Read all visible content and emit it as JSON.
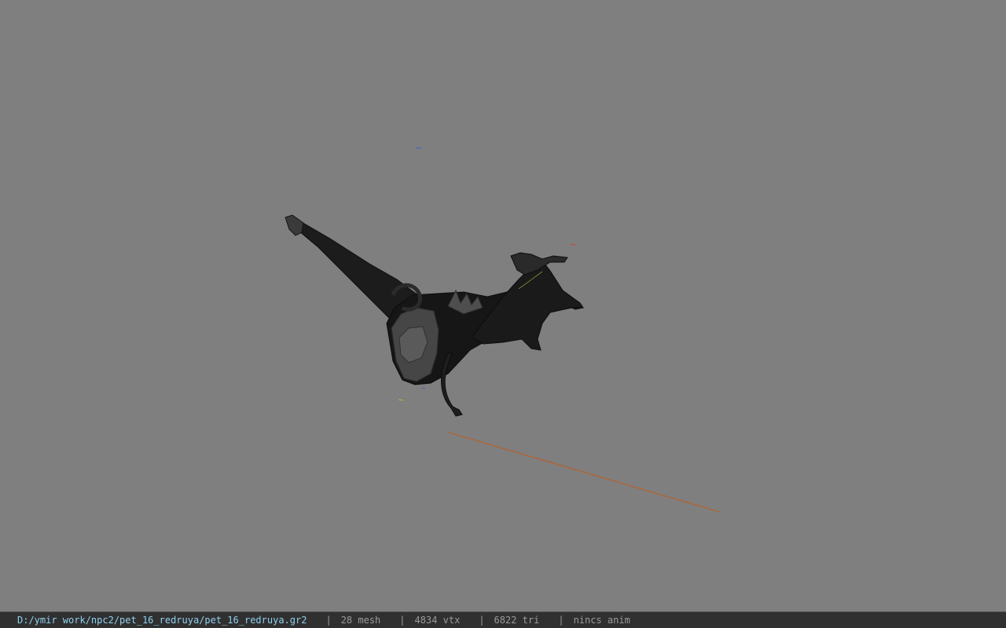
{
  "viewport": {
    "background": "#7f7f7f",
    "model": "bat-winged creature model (dark mesh)"
  },
  "statusbar": {
    "file_path": "D:/ymir work/npc2/pet_16_redruya/pet_16_redruya.gr2",
    "separator": "|",
    "mesh_count": "28 mesh",
    "vertex_count": "4834 vtx",
    "triangle_count": "6822 tri",
    "anim_status": "nincs anim",
    "path_color": "#8fd0f0",
    "text_color": "#9a9a9a"
  }
}
